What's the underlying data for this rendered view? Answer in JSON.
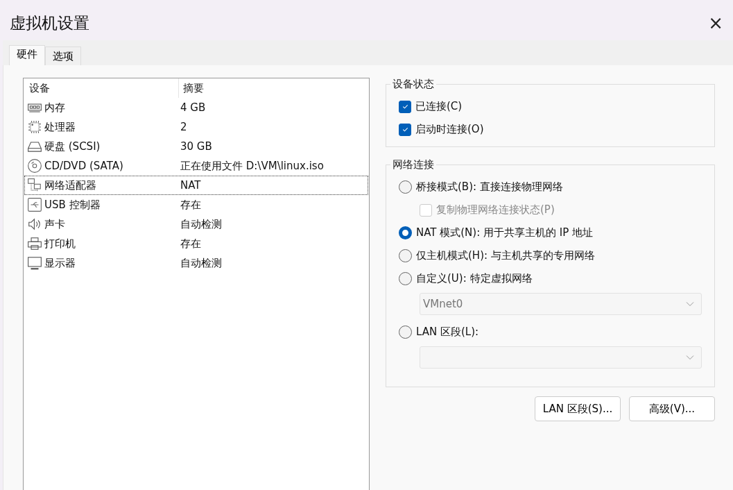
{
  "window": {
    "title": "虚拟机设置",
    "close": "×"
  },
  "tabs": [
    {
      "label": "硬件",
      "selected": true
    },
    {
      "label": "选项",
      "selected": false
    }
  ],
  "devices": {
    "columns": [
      "设备",
      "摘要"
    ],
    "rows": [
      {
        "kind": "memory",
        "name": "内存",
        "summary": "4 GB",
        "selected": false
      },
      {
        "kind": "cpu",
        "name": "处理器",
        "summary": "2",
        "selected": false
      },
      {
        "kind": "disk",
        "name": "硬盘 (SCSI)",
        "summary": "30 GB",
        "selected": false
      },
      {
        "kind": "cd",
        "name": "CD/DVD (SATA)",
        "summary": "正在使用文件 D:\\VM\\linux.iso",
        "selected": false
      },
      {
        "kind": "network",
        "name": "网络适配器",
        "summary": "NAT",
        "selected": true
      },
      {
        "kind": "usb",
        "name": "USB 控制器",
        "summary": "存在",
        "selected": false
      },
      {
        "kind": "sound",
        "name": "声卡",
        "summary": "自动检测",
        "selected": false
      },
      {
        "kind": "printer",
        "name": "打印机",
        "summary": "存在",
        "selected": false
      },
      {
        "kind": "display",
        "name": "显示器",
        "summary": "自动检测",
        "selected": false
      }
    ]
  },
  "device_status": {
    "title": "设备状态",
    "checkboxes": [
      {
        "label": "已连接(C)",
        "checked": true
      },
      {
        "label": "启动时连接(O)",
        "checked": true
      }
    ]
  },
  "network": {
    "title": "网络连接",
    "options": [
      {
        "label": "桥接模式(B): 直接连接物理网络",
        "selected": false,
        "sub_checkbox": {
          "label": "复制物理网络连接状态(P)",
          "checked": false,
          "disabled": true
        }
      },
      {
        "label": "NAT 模式(N): 用于共享主机的 IP 地址",
        "selected": true
      },
      {
        "label": "仅主机模式(H): 与主机共享的专用网络",
        "selected": false
      },
      {
        "label": "自定义(U): 特定虚拟网络",
        "selected": false,
        "dropdown": {
          "value": "VMnet0",
          "disabled": true
        }
      },
      {
        "label": "LAN 区段(L):",
        "selected": false,
        "dropdown": {
          "disabled": true
        }
      }
    ]
  },
  "buttons": [
    "LAN 区段(S)...",
    "高级(V)..."
  ]
}
